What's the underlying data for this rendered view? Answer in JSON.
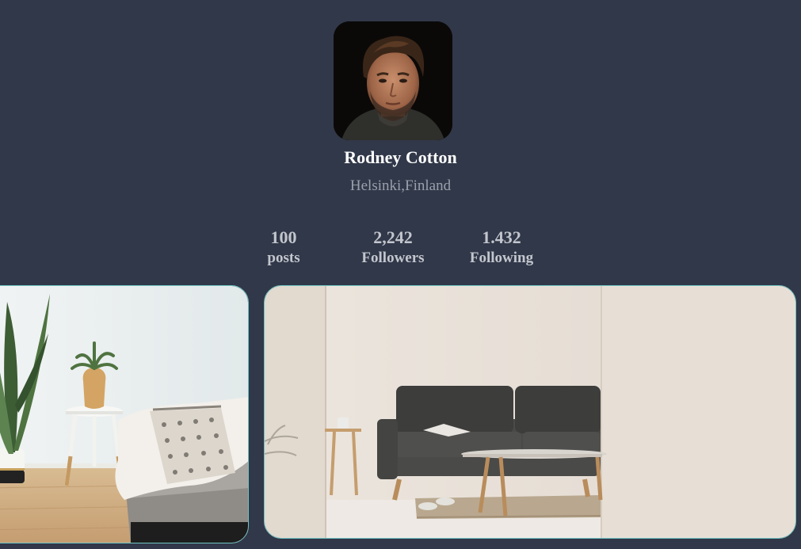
{
  "profile": {
    "name": "Rodney Cotton",
    "location": "Helsinki,Finland",
    "avatar_icon": "profile-photo"
  },
  "stats": [
    {
      "value": "100",
      "label": "posts"
    },
    {
      "value": "2,242",
      "label": "Followers"
    },
    {
      "value": "1.432",
      "label": "Following"
    }
  ],
  "gallery": [
    {
      "icon": "interior-photo-bedroom"
    },
    {
      "icon": "interior-photo-living-room"
    }
  ],
  "colors": {
    "background": "#313849",
    "name_text": "#ffffff",
    "secondary_text": "#9aa0ab",
    "stats_text": "#c3c6cd",
    "photo_border": "#6fc4c2"
  }
}
